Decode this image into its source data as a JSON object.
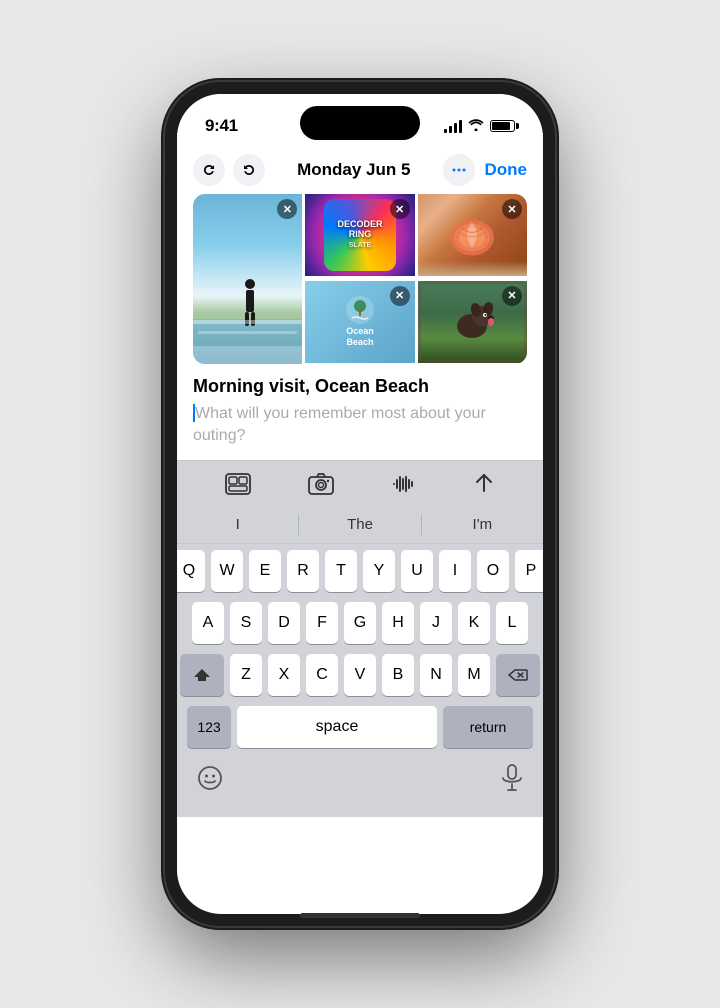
{
  "status_bar": {
    "time": "9:41",
    "battery_level": "85%"
  },
  "header": {
    "undo_label": "↩",
    "redo_label": "↪",
    "date": "Monday Jun 5",
    "more_label": "•••",
    "done_label": "Done"
  },
  "media_grid": {
    "items": [
      {
        "id": "beach-photo",
        "type": "photo",
        "alt": "Person standing at ocean beach"
      },
      {
        "id": "decoder-ring",
        "type": "podcast",
        "alt": "Decoder Ring podcast artwork"
      },
      {
        "id": "seashell",
        "type": "photo",
        "alt": "Seashell on sand"
      },
      {
        "id": "ocean-beach-tile",
        "type": "location",
        "label": "Ocean Beach"
      },
      {
        "id": "dog-photo",
        "type": "photo",
        "alt": "Dog in a car window"
      }
    ]
  },
  "journal": {
    "title": "Morning visit, Ocean Beach",
    "placeholder": "What will you remember most about your outing?"
  },
  "toolbar": {
    "photo_icon": "⊞",
    "camera_icon": "⊡",
    "audio_icon": "||||",
    "send_icon": "➤"
  },
  "autocomplete": {
    "words": [
      "I",
      "The",
      "I'm"
    ]
  },
  "keyboard": {
    "rows": [
      [
        "Q",
        "W",
        "E",
        "R",
        "T",
        "Y",
        "U",
        "I",
        "O",
        "P"
      ],
      [
        "A",
        "S",
        "D",
        "F",
        "G",
        "H",
        "J",
        "K",
        "L"
      ],
      [
        "⇧",
        "Z",
        "X",
        "C",
        "V",
        "B",
        "N",
        "M",
        "⌫"
      ],
      [
        "123",
        "space",
        "return"
      ]
    ]
  },
  "bottom_bar": {
    "emoji_icon": "😊",
    "mic_icon": "🎤"
  }
}
